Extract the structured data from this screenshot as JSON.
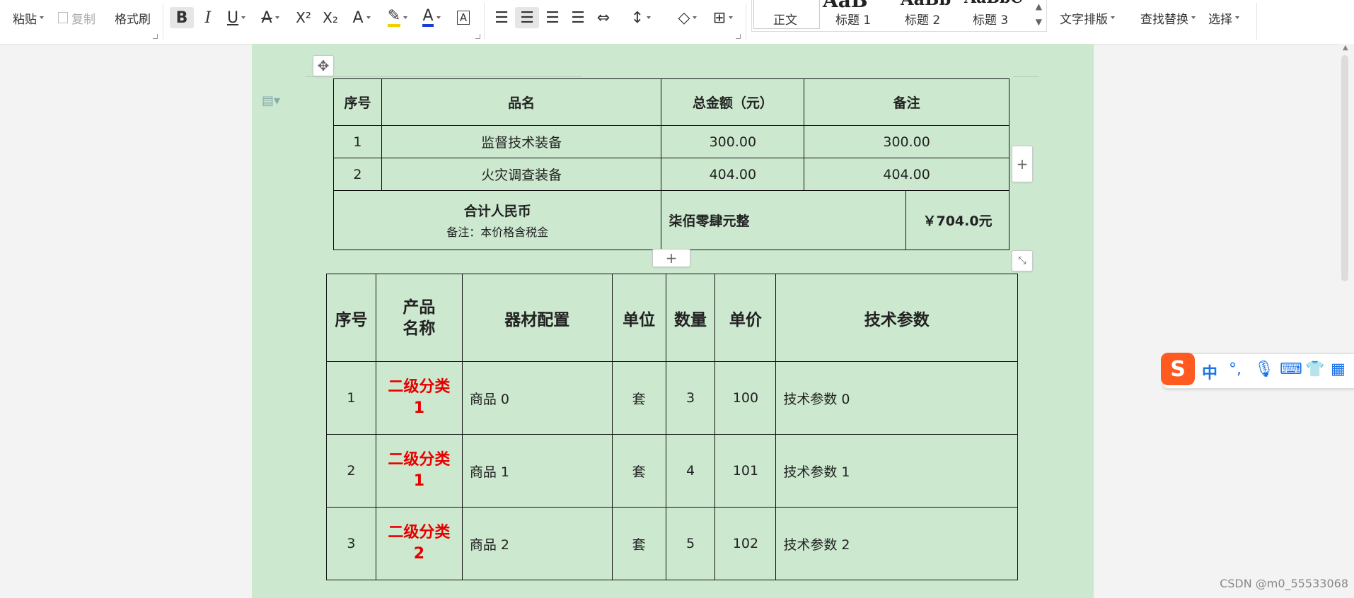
{
  "ribbon": {
    "paste": "粘贴",
    "copy": "复制",
    "format_painter": "格式刷",
    "styles": {
      "normal": "正文",
      "heading1": "标题 1",
      "heading2": "标题 2",
      "heading3": "标题 3",
      "preview_big": "AaB",
      "preview_mid": "AaBb",
      "preview_right": "AaBbC"
    },
    "text_layout": "文字排版",
    "find_replace": "查找替换",
    "select": "选择"
  },
  "table1": {
    "headers": [
      "序号",
      "品名",
      "总金额（元）",
      "备注"
    ],
    "rows": [
      [
        "1",
        "监督技术装备",
        "300.00",
        "300.00"
      ],
      [
        "2",
        "火灾调查装备",
        "404.00",
        "404.00"
      ]
    ],
    "total_label": "合计人民币",
    "total_note": "备注：本价格含税金",
    "total_words": "柒佰零肆元整",
    "total_amount": "￥704.0元"
  },
  "table2": {
    "headers": [
      "序号",
      "产品名称",
      "器材配置",
      "单位",
      "数量",
      "单价",
      "技术参数"
    ],
    "rows": [
      [
        "1",
        "二级分类1",
        "商品 0",
        "套",
        "3",
        "100",
        "技术参数 0"
      ],
      [
        "2",
        "二级分类1",
        "商品 1",
        "套",
        "4",
        "101",
        "技术参数 1"
      ],
      [
        "3",
        "二级分类2",
        "商品 2",
        "套",
        "5",
        "102",
        "技术参数 2"
      ]
    ]
  },
  "ime": {
    "lang": "中",
    "punct": "°,"
  },
  "watermark": "CSDN @m0_55533068",
  "colors": {
    "page_bg": "#cce8cf",
    "category_red": "#e80000"
  }
}
